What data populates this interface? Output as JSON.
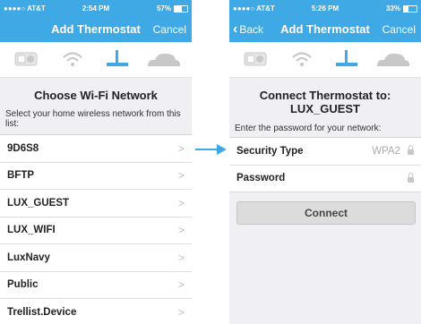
{
  "left": {
    "status": {
      "carrier": "●●●●○ AT&T",
      "time": "2:54 PM",
      "battery": "57%",
      "battery_level": 0.57
    },
    "nav": {
      "title": "Add Thermostat",
      "cancel": "Cancel"
    },
    "heading": "Choose Wi-Fi Network",
    "subtext": "Select your home wireless network from this list:",
    "networks": [
      "9D6S8",
      "BFTP",
      "LUX_GUEST",
      "LUX_WIFI",
      "LuxNavy",
      "Public",
      "Trellist.Device"
    ],
    "chevron": ">"
  },
  "right": {
    "status": {
      "carrier": "●●●●○ AT&T",
      "time": "5:26 PM",
      "battery": "33%",
      "battery_level": 0.33
    },
    "nav": {
      "back": "Back",
      "title": "Add Thermostat",
      "cancel": "Cancel"
    },
    "heading": "Connect Thermostat to: LUX_GUEST",
    "subtext": "Enter the password for your network:",
    "security_label": "Security Type",
    "security_value": "WPA2",
    "password_label": "Password",
    "connect_button": "Connect"
  },
  "colors": {
    "accent": "#3fa9e6",
    "background": "#efeff4",
    "step_active": "#3fa9e6",
    "step_inactive": "#c8c8c8"
  }
}
